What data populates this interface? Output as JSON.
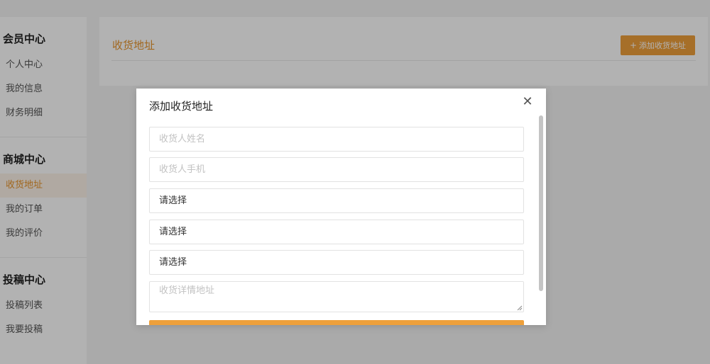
{
  "sidebar": {
    "groups": [
      {
        "title": "会员中心",
        "items": [
          "个人中心",
          "我的信息",
          "财务明细"
        ]
      },
      {
        "title": "商城中心",
        "items": [
          "收货地址",
          "我的订单",
          "我的评价"
        ]
      },
      {
        "title": "投稿中心",
        "items": [
          "投稿列表",
          "我要投稿"
        ]
      }
    ],
    "active_item": "收货地址"
  },
  "main": {
    "title": "收货地址",
    "add_button": {
      "icon": "plus-icon",
      "label": "添加收货地址"
    }
  },
  "modal": {
    "title": "添加收货地址",
    "close_icon": "close-icon",
    "fields": {
      "name_placeholder": "收货人姓名",
      "phone_placeholder": "收货人手机",
      "province_value": "请选择",
      "city_value": "请选择",
      "district_value": "请选择",
      "detail_placeholder": "收货详情地址"
    }
  },
  "colors": {
    "accent": "#eea03b",
    "accent_text": "#e7942b",
    "overlay": "rgba(0,0,0,0.30)"
  }
}
